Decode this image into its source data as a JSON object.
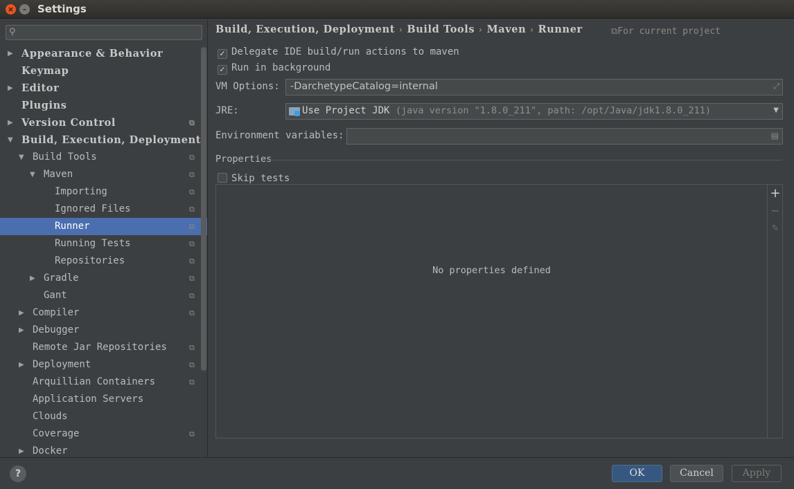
{
  "window": {
    "title": "Settings"
  },
  "search": {
    "placeholder": "",
    "value": ""
  },
  "tree": [
    {
      "label": "Appearance & Behavior",
      "level": 0,
      "arrow": "right",
      "proj": false,
      "selected": false
    },
    {
      "label": "Keymap",
      "level": 0,
      "arrow": "none",
      "proj": false,
      "selected": false
    },
    {
      "label": "Editor",
      "level": 0,
      "arrow": "right",
      "proj": false,
      "selected": false
    },
    {
      "label": "Plugins",
      "level": 0,
      "arrow": "none",
      "proj": false,
      "selected": false
    },
    {
      "label": "Version Control",
      "level": 0,
      "arrow": "right",
      "proj": true,
      "selected": false
    },
    {
      "label": "Build, Execution, Deployment",
      "level": 0,
      "arrow": "down",
      "proj": false,
      "selected": false
    },
    {
      "label": "Build Tools",
      "level": 1,
      "arrow": "down",
      "proj": true,
      "selected": false
    },
    {
      "label": "Maven",
      "level": 2,
      "arrow": "down",
      "proj": true,
      "selected": false
    },
    {
      "label": "Importing",
      "level": 3,
      "arrow": "none",
      "proj": true,
      "selected": false
    },
    {
      "label": "Ignored Files",
      "level": 3,
      "arrow": "none",
      "proj": true,
      "selected": false
    },
    {
      "label": "Runner",
      "level": 3,
      "arrow": "none",
      "proj": true,
      "selected": true
    },
    {
      "label": "Running Tests",
      "level": 3,
      "arrow": "none",
      "proj": true,
      "selected": false
    },
    {
      "label": "Repositories",
      "level": 3,
      "arrow": "none",
      "proj": true,
      "selected": false
    },
    {
      "label": "Gradle",
      "level": 2,
      "arrow": "right",
      "proj": true,
      "selected": false
    },
    {
      "label": "Gant",
      "level": 2,
      "arrow": "none",
      "proj": true,
      "selected": false
    },
    {
      "label": "Compiler",
      "level": 1,
      "arrow": "right",
      "proj": true,
      "selected": false
    },
    {
      "label": "Debugger",
      "level": 1,
      "arrow": "right",
      "proj": false,
      "selected": false
    },
    {
      "label": "Remote Jar Repositories",
      "level": 1,
      "arrow": "none",
      "proj": true,
      "selected": false
    },
    {
      "label": "Deployment",
      "level": 1,
      "arrow": "right",
      "proj": true,
      "selected": false
    },
    {
      "label": "Arquillian Containers",
      "level": 1,
      "arrow": "none",
      "proj": true,
      "selected": false
    },
    {
      "label": "Application Servers",
      "level": 1,
      "arrow": "none",
      "proj": false,
      "selected": false
    },
    {
      "label": "Clouds",
      "level": 1,
      "arrow": "none",
      "proj": false,
      "selected": false
    },
    {
      "label": "Coverage",
      "level": 1,
      "arrow": "none",
      "proj": true,
      "selected": false
    },
    {
      "label": "Docker",
      "level": 1,
      "arrow": "right",
      "proj": false,
      "selected": false
    }
  ],
  "breadcrumb": [
    "Build, Execution, Deployment",
    "Build Tools",
    "Maven",
    "Runner"
  ],
  "for_project": "For current project",
  "options": {
    "delegate": {
      "label": "Delegate IDE build/run actions to maven",
      "checked": true
    },
    "background": {
      "label": "Run in background",
      "checked": true
    },
    "vm_label": "VM Options:",
    "vm_value": "-DarchetypeCatalog=internal",
    "jre_label": "JRE:",
    "jre_value": "Use Project JDK",
    "jre_detail": "(java version \"1.8.0_211\", path: /opt/Java/jdk1.8.0_211)",
    "env_label": "Environment variables:",
    "env_value": ""
  },
  "properties": {
    "title": "Properties",
    "skip_tests": {
      "label": "Skip tests",
      "checked": false
    },
    "empty_text": "No properties defined"
  },
  "buttons": {
    "ok": "OK",
    "cancel": "Cancel",
    "apply": "Apply",
    "help": "?"
  }
}
